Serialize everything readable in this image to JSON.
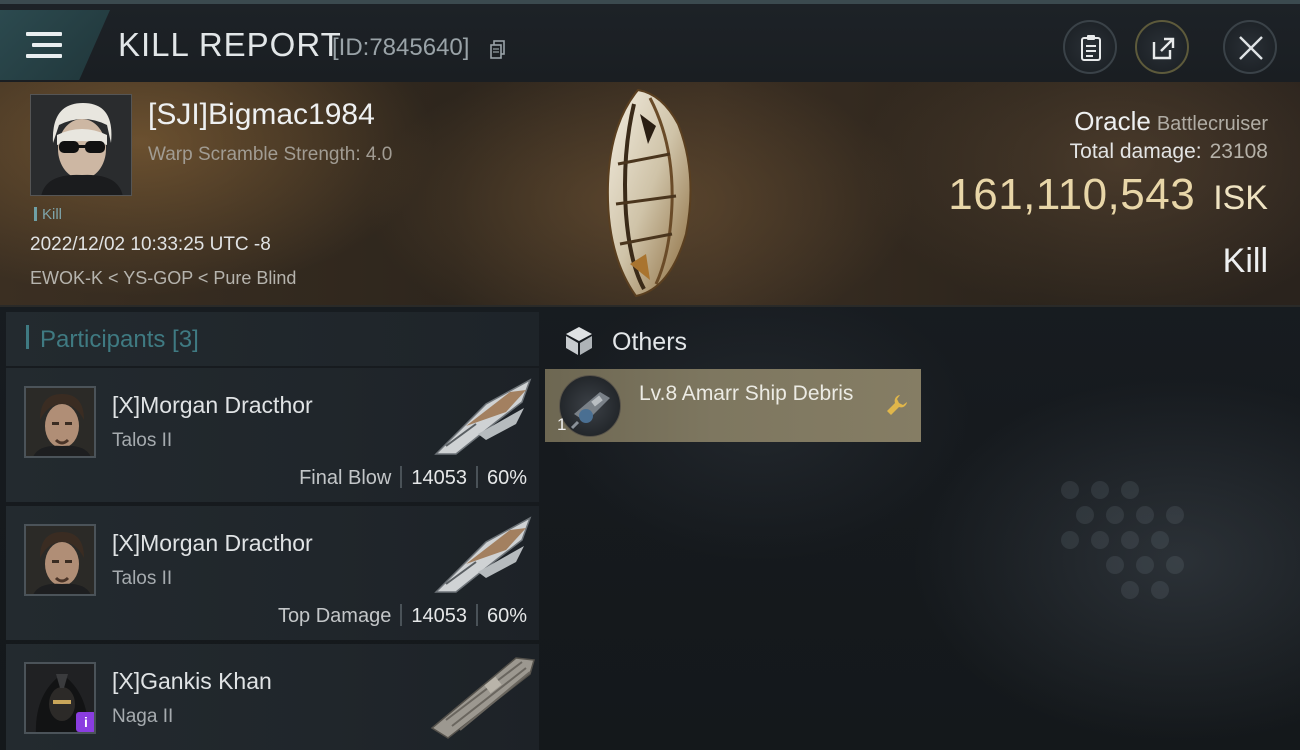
{
  "header": {
    "title": "KILL REPORT",
    "report_id": "[ID:7845640]"
  },
  "icons": {
    "menu": "hamburger-menu-icon",
    "copy": "copy-icon",
    "clipboard": "clipboard-icon",
    "share": "share-export-icon",
    "close": "close-icon",
    "others": "cube-icon",
    "fit": "wrench-icon",
    "info": "info-badge-icon"
  },
  "victim": {
    "name": "[SJI]Bigmac1984",
    "warp_scramble": "Warp Scramble Strength: 4.0",
    "tag": "Kill",
    "datetime": "2022/12/02 10:33:25 UTC -8",
    "location": "EWOK-K < YS-GOP < Pure Blind",
    "ship_name": "Oracle",
    "ship_class": "Battlecruiser",
    "total_damage_label": "Total damage:",
    "total_damage": "23108",
    "isk_value": "161,110,543",
    "isk_unit": "ISK",
    "result": "Kill"
  },
  "participants": {
    "title": "Participants [3]",
    "items": [
      {
        "name": "[X]Morgan Dracthor",
        "ship": "Talos II",
        "role": "Final Blow",
        "damage": "14053",
        "percent": "60%"
      },
      {
        "name": "[X]Morgan Dracthor",
        "ship": "Talos II",
        "role": "Top Damage",
        "damage": "14053",
        "percent": "60%"
      },
      {
        "name": "[X]Gankis Khan",
        "ship": "Naga II",
        "role": "",
        "damage": "",
        "percent": "",
        "badge": "i"
      }
    ]
  },
  "others": {
    "title": "Others",
    "items": [
      {
        "name": "Lv.8 Amarr Ship Debris",
        "quantity": "1"
      }
    ]
  },
  "colors": {
    "accent_teal": "#3f7a82",
    "isk_gold": "#e8d6a8",
    "loot_bg": "#7e7760",
    "badge_purple": "#8a3de0"
  }
}
